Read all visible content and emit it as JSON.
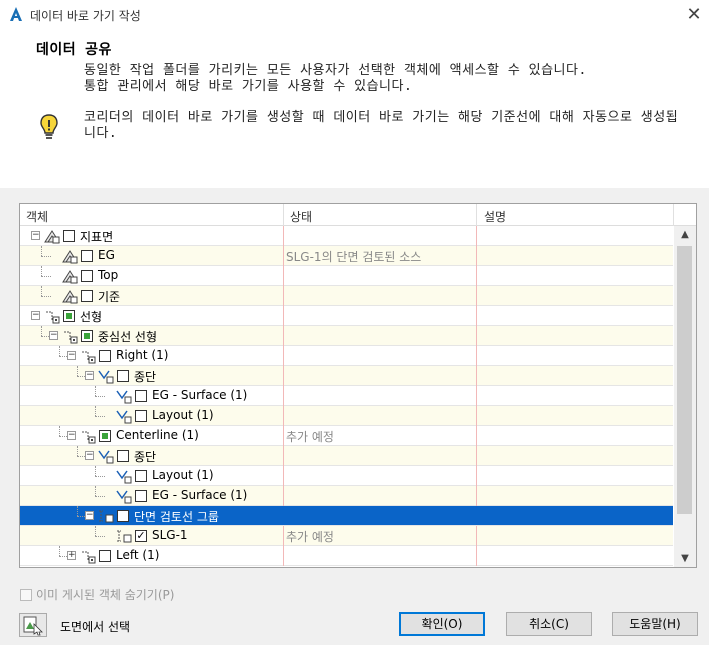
{
  "window": {
    "title": "데이터 바로 가기 작성",
    "close_glyph": "✕"
  },
  "header": {
    "title": "데이터 공유",
    "desc_line1": "동일한 작업 폴더를 가리키는 모든 사용자가 선택한 객체에 액세스할 수 있습니다.",
    "desc_line2": "통합 관리에서 해당 바로 가기를 사용할 수 있습니다.",
    "note": "코리더의 데이터 바로 가기를 생성할 때 데이터 바로 가기는 해당 기준선에 대해 자동으로 생성됩니다."
  },
  "grid": {
    "columns": [
      "객체",
      "상태",
      "설명"
    ],
    "rows": [
      {
        "label": "지표면",
        "status": "",
        "depth": 0,
        "exp": "minus",
        "icon": "surface",
        "check": "none"
      },
      {
        "label": "EG",
        "status": "SLG-1의 단면 검토된 소스",
        "depth": 1,
        "exp": "",
        "icon": "surface",
        "check": "none"
      },
      {
        "label": "Top",
        "status": "",
        "depth": 1,
        "exp": "",
        "icon": "surface",
        "check": "none"
      },
      {
        "label": "기준",
        "status": "",
        "depth": 1,
        "exp": "",
        "icon": "surface",
        "check": "none"
      },
      {
        "label": "선형",
        "status": "",
        "depth": 0,
        "exp": "minus",
        "icon": "alignment",
        "check": "partial"
      },
      {
        "label": "중심선 선형",
        "status": "",
        "depth": 1,
        "exp": "minus",
        "icon": "alignment",
        "check": "partial"
      },
      {
        "label": "Right (1)",
        "status": "",
        "depth": 2,
        "exp": "minus",
        "icon": "alignment",
        "check": "none"
      },
      {
        "label": "종단",
        "status": "",
        "depth": 3,
        "exp": "minus",
        "icon": "profile",
        "check": "none"
      },
      {
        "label": "EG - Surface (1)",
        "status": "",
        "depth": 4,
        "exp": "",
        "icon": "profile",
        "check": "none"
      },
      {
        "label": "Layout (1)",
        "status": "",
        "depth": 4,
        "exp": "",
        "icon": "profile",
        "check": "none"
      },
      {
        "label": "Centerline (1)",
        "status": "추가 예정",
        "depth": 2,
        "exp": "minus",
        "icon": "alignment",
        "check": "partial"
      },
      {
        "label": "종단",
        "status": "",
        "depth": 3,
        "exp": "minus",
        "icon": "profile",
        "check": "none"
      },
      {
        "label": "Layout (1)",
        "status": "",
        "depth": 4,
        "exp": "",
        "icon": "profile",
        "check": "none"
      },
      {
        "label": "EG - Surface (1)",
        "status": "",
        "depth": 4,
        "exp": "",
        "icon": "profile",
        "check": "none"
      },
      {
        "label": "단면 검토선 그룹",
        "status": "",
        "depth": 3,
        "exp": "minus",
        "icon": "sample",
        "check": "checked",
        "selected": true
      },
      {
        "label": "SLG-1",
        "status": "추가 예정",
        "depth": 4,
        "exp": "",
        "icon": "sample",
        "check": "checked"
      },
      {
        "label": "Left (1)",
        "status": "",
        "depth": 2,
        "exp": "plus",
        "icon": "alignment",
        "check": "none"
      }
    ]
  },
  "footer": {
    "hide_published": "이미 게시된 객체 숨기기(P)",
    "pick_label": "도면에서 선택",
    "ok": "확인(O)",
    "cancel": "취소(C)",
    "help": "도움말(H)"
  },
  "colors": {
    "selected": "#0a64c8",
    "row_tint": "#fdfcec",
    "accent": "#0078d7"
  }
}
